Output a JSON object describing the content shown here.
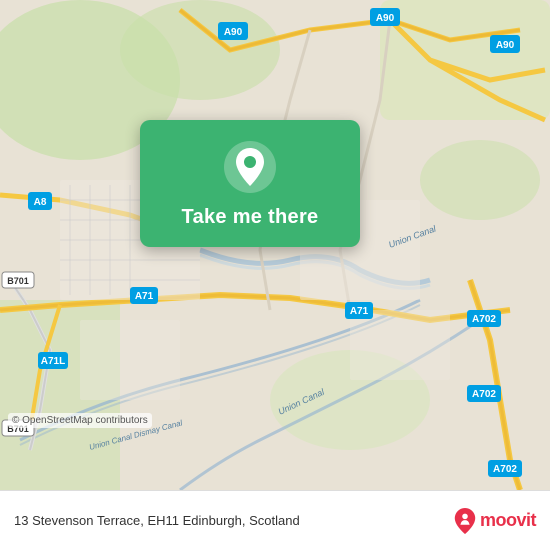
{
  "map": {
    "attribution": "© OpenStreetMap contributors",
    "background_color": "#e8e0d0"
  },
  "card": {
    "button_label": "Take me there",
    "pin_color": "#ffffff"
  },
  "bottom_bar": {
    "address": "13 Stevenson Terrace, EH11 Edinburgh, Scotland",
    "logo_text": "moovit"
  },
  "road_labels": [
    "A90",
    "A90",
    "A90",
    "A8",
    "B701",
    "B701",
    "A71",
    "A71L",
    "A71",
    "A702",
    "A702",
    "A702",
    "Union Canal",
    "Union Canal",
    "Union Canal Dismay Canal"
  ]
}
